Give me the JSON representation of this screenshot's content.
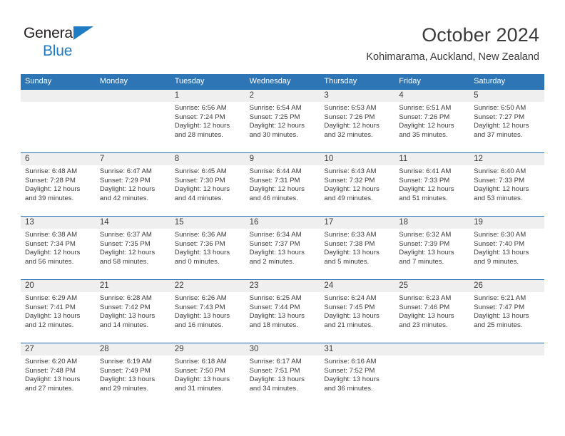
{
  "brand": {
    "name_top": "General",
    "name_bottom": "Blue",
    "flag_icon": "triangle-flag-icon"
  },
  "header": {
    "title": "October 2024",
    "subtitle": "Kohimarama, Auckland, New Zealand"
  },
  "colors": {
    "header_blue": "#2e75b6",
    "row_divider_blue": "#1f6cb0",
    "date_band_gray": "#efefef",
    "brand_blue": "#1d7cc4",
    "text": "#3b3b3b"
  },
  "weekdays": [
    "Sunday",
    "Monday",
    "Tuesday",
    "Wednesday",
    "Thursday",
    "Friday",
    "Saturday"
  ],
  "weeks": [
    [
      {
        "day": "",
        "lines": []
      },
      {
        "day": "",
        "lines": []
      },
      {
        "day": "1",
        "lines": [
          "Sunrise: 6:56 AM",
          "Sunset: 7:24 PM",
          "Daylight: 12 hours",
          "and 28 minutes."
        ]
      },
      {
        "day": "2",
        "lines": [
          "Sunrise: 6:54 AM",
          "Sunset: 7:25 PM",
          "Daylight: 12 hours",
          "and 30 minutes."
        ]
      },
      {
        "day": "3",
        "lines": [
          "Sunrise: 6:53 AM",
          "Sunset: 7:26 PM",
          "Daylight: 12 hours",
          "and 32 minutes."
        ]
      },
      {
        "day": "4",
        "lines": [
          "Sunrise: 6:51 AM",
          "Sunset: 7:26 PM",
          "Daylight: 12 hours",
          "and 35 minutes."
        ]
      },
      {
        "day": "5",
        "lines": [
          "Sunrise: 6:50 AM",
          "Sunset: 7:27 PM",
          "Daylight: 12 hours",
          "and 37 minutes."
        ]
      }
    ],
    [
      {
        "day": "6",
        "lines": [
          "Sunrise: 6:48 AM",
          "Sunset: 7:28 PM",
          "Daylight: 12 hours",
          "and 39 minutes."
        ]
      },
      {
        "day": "7",
        "lines": [
          "Sunrise: 6:47 AM",
          "Sunset: 7:29 PM",
          "Daylight: 12 hours",
          "and 42 minutes."
        ]
      },
      {
        "day": "8",
        "lines": [
          "Sunrise: 6:45 AM",
          "Sunset: 7:30 PM",
          "Daylight: 12 hours",
          "and 44 minutes."
        ]
      },
      {
        "day": "9",
        "lines": [
          "Sunrise: 6:44 AM",
          "Sunset: 7:31 PM",
          "Daylight: 12 hours",
          "and 46 minutes."
        ]
      },
      {
        "day": "10",
        "lines": [
          "Sunrise: 6:43 AM",
          "Sunset: 7:32 PM",
          "Daylight: 12 hours",
          "and 49 minutes."
        ]
      },
      {
        "day": "11",
        "lines": [
          "Sunrise: 6:41 AM",
          "Sunset: 7:33 PM",
          "Daylight: 12 hours",
          "and 51 minutes."
        ]
      },
      {
        "day": "12",
        "lines": [
          "Sunrise: 6:40 AM",
          "Sunset: 7:33 PM",
          "Daylight: 12 hours",
          "and 53 minutes."
        ]
      }
    ],
    [
      {
        "day": "13",
        "lines": [
          "Sunrise: 6:38 AM",
          "Sunset: 7:34 PM",
          "Daylight: 12 hours",
          "and 56 minutes."
        ]
      },
      {
        "day": "14",
        "lines": [
          "Sunrise: 6:37 AM",
          "Sunset: 7:35 PM",
          "Daylight: 12 hours",
          "and 58 minutes."
        ]
      },
      {
        "day": "15",
        "lines": [
          "Sunrise: 6:36 AM",
          "Sunset: 7:36 PM",
          "Daylight: 13 hours",
          "and 0 minutes."
        ]
      },
      {
        "day": "16",
        "lines": [
          "Sunrise: 6:34 AM",
          "Sunset: 7:37 PM",
          "Daylight: 13 hours",
          "and 2 minutes."
        ]
      },
      {
        "day": "17",
        "lines": [
          "Sunrise: 6:33 AM",
          "Sunset: 7:38 PM",
          "Daylight: 13 hours",
          "and 5 minutes."
        ]
      },
      {
        "day": "18",
        "lines": [
          "Sunrise: 6:32 AM",
          "Sunset: 7:39 PM",
          "Daylight: 13 hours",
          "and 7 minutes."
        ]
      },
      {
        "day": "19",
        "lines": [
          "Sunrise: 6:30 AM",
          "Sunset: 7:40 PM",
          "Daylight: 13 hours",
          "and 9 minutes."
        ]
      }
    ],
    [
      {
        "day": "20",
        "lines": [
          "Sunrise: 6:29 AM",
          "Sunset: 7:41 PM",
          "Daylight: 13 hours",
          "and 12 minutes."
        ]
      },
      {
        "day": "21",
        "lines": [
          "Sunrise: 6:28 AM",
          "Sunset: 7:42 PM",
          "Daylight: 13 hours",
          "and 14 minutes."
        ]
      },
      {
        "day": "22",
        "lines": [
          "Sunrise: 6:26 AM",
          "Sunset: 7:43 PM",
          "Daylight: 13 hours",
          "and 16 minutes."
        ]
      },
      {
        "day": "23",
        "lines": [
          "Sunrise: 6:25 AM",
          "Sunset: 7:44 PM",
          "Daylight: 13 hours",
          "and 18 minutes."
        ]
      },
      {
        "day": "24",
        "lines": [
          "Sunrise: 6:24 AM",
          "Sunset: 7:45 PM",
          "Daylight: 13 hours",
          "and 21 minutes."
        ]
      },
      {
        "day": "25",
        "lines": [
          "Sunrise: 6:23 AM",
          "Sunset: 7:46 PM",
          "Daylight: 13 hours",
          "and 23 minutes."
        ]
      },
      {
        "day": "26",
        "lines": [
          "Sunrise: 6:21 AM",
          "Sunset: 7:47 PM",
          "Daylight: 13 hours",
          "and 25 minutes."
        ]
      }
    ],
    [
      {
        "day": "27",
        "lines": [
          "Sunrise: 6:20 AM",
          "Sunset: 7:48 PM",
          "Daylight: 13 hours",
          "and 27 minutes."
        ]
      },
      {
        "day": "28",
        "lines": [
          "Sunrise: 6:19 AM",
          "Sunset: 7:49 PM",
          "Daylight: 13 hours",
          "and 29 minutes."
        ]
      },
      {
        "day": "29",
        "lines": [
          "Sunrise: 6:18 AM",
          "Sunset: 7:50 PM",
          "Daylight: 13 hours",
          "and 31 minutes."
        ]
      },
      {
        "day": "30",
        "lines": [
          "Sunrise: 6:17 AM",
          "Sunset: 7:51 PM",
          "Daylight: 13 hours",
          "and 34 minutes."
        ]
      },
      {
        "day": "31",
        "lines": [
          "Sunrise: 6:16 AM",
          "Sunset: 7:52 PM",
          "Daylight: 13 hours",
          "and 36 minutes."
        ]
      },
      {
        "day": "",
        "lines": []
      },
      {
        "day": "",
        "lines": []
      }
    ]
  ]
}
